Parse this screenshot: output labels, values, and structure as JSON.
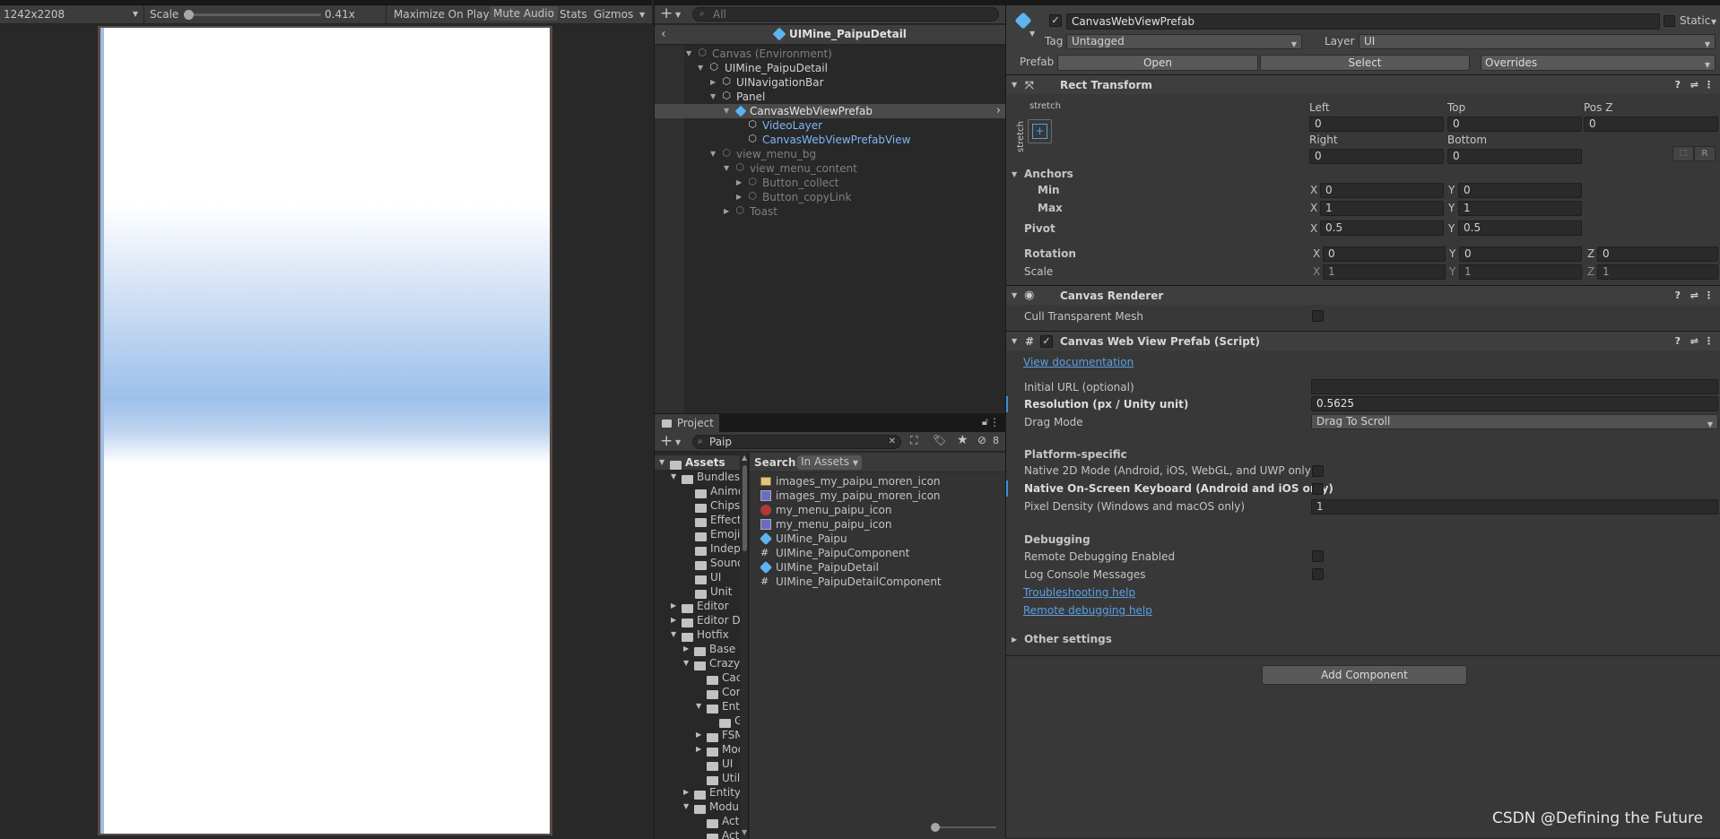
{
  "game": {
    "resolution": "1242x2208",
    "scale_label": "Scale",
    "scale_value": "0.41x",
    "maximize": "Maximize On Play",
    "mute": "Mute Audio",
    "stats": "Stats",
    "gizmos": "Gizmos"
  },
  "hierarchy": {
    "search_placeholder": "All",
    "scene_title": "UIMine_PaipuDetail",
    "items": [
      {
        "label": "Canvas (Environment)"
      },
      {
        "label": "UIMine_PaipuDetail"
      },
      {
        "label": "UINavigationBar"
      },
      {
        "label": "Panel"
      },
      {
        "label": "CanvasWebViewPrefab"
      },
      {
        "label": "VideoLayer"
      },
      {
        "label": "CanvasWebViewPrefabView"
      },
      {
        "label": "view_menu_bg"
      },
      {
        "label": "view_menu_content"
      },
      {
        "label": "Button_collect"
      },
      {
        "label": "Button_copyLink"
      },
      {
        "label": "Toast"
      }
    ]
  },
  "project": {
    "tab": "Project",
    "search_value": "Paip",
    "badge": "8",
    "search_label": "Search:",
    "search_scope": "In Assets",
    "tree": [
      {
        "label": "Assets"
      },
      {
        "label": "Bundles"
      },
      {
        "label": "Animo"
      },
      {
        "label": "Chips"
      },
      {
        "label": "Effect"
      },
      {
        "label": "Emoji"
      },
      {
        "label": "Indepe"
      },
      {
        "label": "Sound"
      },
      {
        "label": "UI"
      },
      {
        "label": "Unit"
      },
      {
        "label": "Editor"
      },
      {
        "label": "Editor De"
      },
      {
        "label": "Hotfix"
      },
      {
        "label": "Base"
      },
      {
        "label": "Crazy"
      },
      {
        "label": "Cac"
      },
      {
        "label": "Cor"
      },
      {
        "label": "Enti"
      },
      {
        "label": "G"
      },
      {
        "label": "FSM"
      },
      {
        "label": "Mod"
      },
      {
        "label": "UI"
      },
      {
        "label": "Util"
      },
      {
        "label": "Entity"
      },
      {
        "label": "Modul"
      },
      {
        "label": "Act"
      },
      {
        "label": "Act"
      }
    ],
    "results": [
      {
        "label": "images_my_paipu_moren_icon",
        "icon": "image-asset-icon"
      },
      {
        "label": "images_my_paipu_moren_icon",
        "icon": "sprite-icon"
      },
      {
        "label": "my_menu_paipu_icon",
        "icon": "texture-icon"
      },
      {
        "label": "my_menu_paipu_icon",
        "icon": "sprite-icon"
      },
      {
        "label": "UIMine_Paipu",
        "icon": "prefab-icon"
      },
      {
        "label": "UIMine_PaipuComponent",
        "icon": "script-icon"
      },
      {
        "label": "UIMine_PaipuDetail",
        "icon": "prefab-icon"
      },
      {
        "label": "UIMine_PaipuDetailComponent",
        "icon": "script-icon"
      }
    ]
  },
  "inspector": {
    "object_name": "CanvasWebViewPrefab",
    "static_label": "Static",
    "tag_label": "Tag",
    "tag_value": "Untagged",
    "layer_label": "Layer",
    "layer_value": "UI",
    "prefab_label": "Prefab",
    "open": "Open",
    "select": "Select",
    "overrides": "Overrides",
    "rect": {
      "title": "Rect Transform",
      "stretch_h": "stretch",
      "stretch_v": "stretch",
      "left_label": "Left",
      "left": "0",
      "top_label": "Top",
      "top": "0",
      "posz_label": "Pos Z",
      "posz": "0",
      "right_label": "Right",
      "right": "0",
      "bottom_label": "Bottom",
      "bottom": "0",
      "r_btn": "R",
      "anchors": "Anchors",
      "min": "Min",
      "max": "Max",
      "pivot": "Pivot",
      "rotation": "Rotation",
      "scale": "Scale",
      "x": "X",
      "y": "Y",
      "z": "Z",
      "min_x": "0",
      "min_y": "0",
      "max_x": "1",
      "max_y": "1",
      "pivot_x": "0.5",
      "pivot_y": "0.5",
      "rot_x": "0",
      "rot_y": "0",
      "rot_z": "0",
      "scale_x": "1",
      "scale_y": "1",
      "scale_z": "1"
    },
    "renderer": {
      "title": "Canvas Renderer",
      "cull": "Cull Transparent Mesh"
    },
    "script": {
      "title": "Canvas Web View Prefab (Script)",
      "view_doc": "View documentation",
      "initial_url": "Initial URL (optional)",
      "resolution": "Resolution (px / Unity unit)",
      "resolution_value": "0.5625",
      "drag_mode": "Drag Mode",
      "drag_value": "Drag To Scroll",
      "platform": "Platform-specific",
      "native2d": "Native 2D Mode (Android, iOS, WebGL, and UWP only)",
      "keyboard": "Native On-Screen Keyboard (Android and iOS only)",
      "pixel_density": "Pixel Density (Windows and macOS only)",
      "pixel_density_value": "1",
      "debugging": "Debugging",
      "remote_debug": "Remote Debugging Enabled",
      "log_console": "Log Console Messages",
      "troubleshooting": "Troubleshooting help",
      "remote_help": "Remote debugging help",
      "other": "Other settings"
    },
    "add_component": "Add Component"
  },
  "watermark": "CSDN @Defining the Future"
}
